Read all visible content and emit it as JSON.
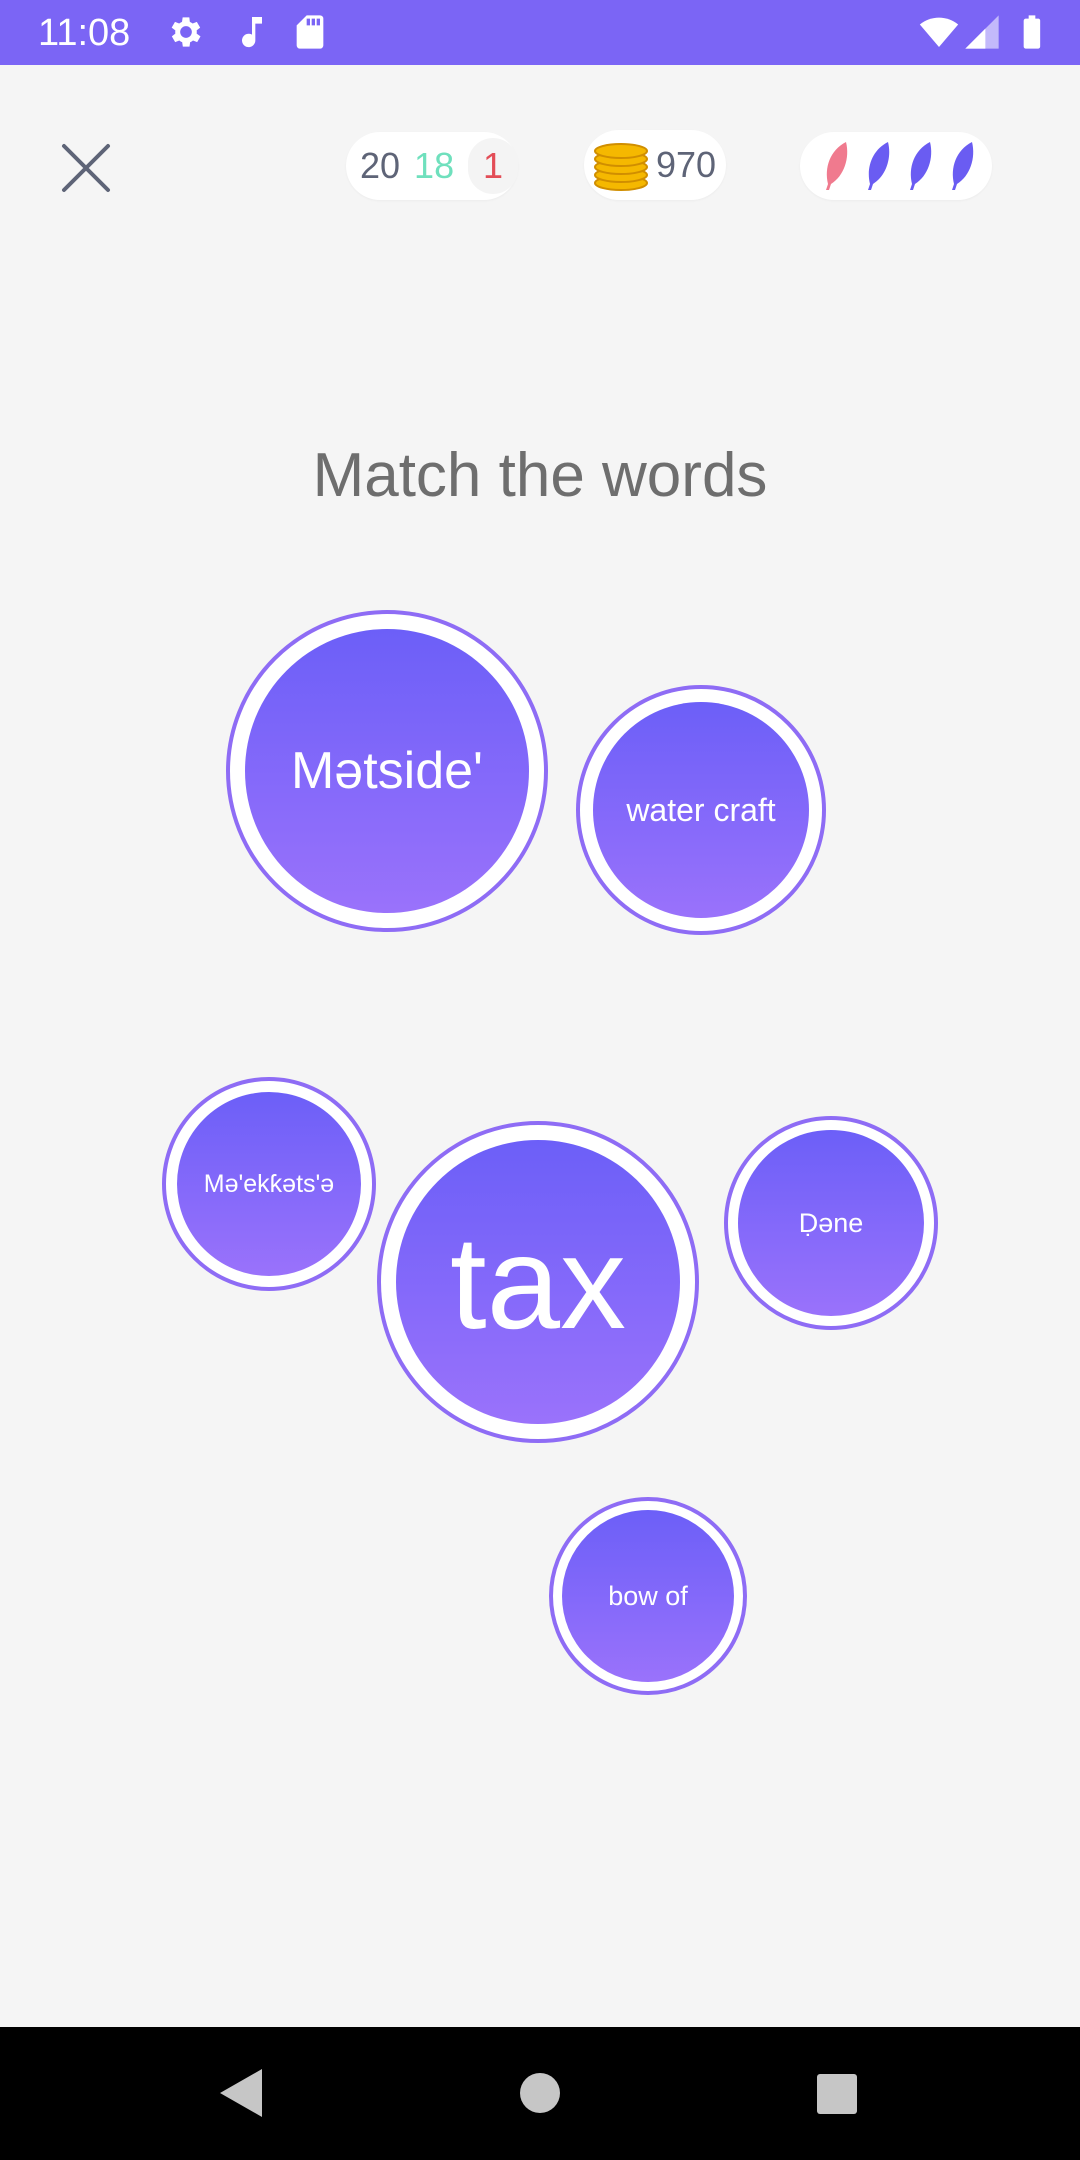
{
  "status_bar": {
    "time": "11:08",
    "left_icons": [
      "gear-icon",
      "music-note-icon",
      "sd-card-icon"
    ],
    "right_icons": [
      "wifi-icon",
      "signal-icon",
      "battery-icon"
    ]
  },
  "header": {
    "close_icon": "close-icon",
    "score": {
      "total": "20",
      "correct": "18",
      "wrong": "1"
    },
    "coins": "970",
    "feathers": [
      {
        "icon": "feather-icon",
        "color": "#f07a8e"
      },
      {
        "icon": "feather-icon",
        "color": "#6a5cf2"
      },
      {
        "icon": "feather-icon",
        "color": "#6a5cf2"
      },
      {
        "icon": "feather-icon",
        "color": "#6a5cf2"
      }
    ]
  },
  "prompt": "Match the words",
  "bubbles": [
    {
      "label": "Mətside'"
    },
    {
      "label": "water craft"
    },
    {
      "label": "Mə'ekƙəts'ə"
    },
    {
      "label": "tax"
    },
    {
      "label": "Ḍəne"
    },
    {
      "label": "bow of"
    }
  ],
  "colors": {
    "accent": "#7b65f5",
    "bubble_top": "#6c5ff8",
    "bubble_bottom": "#9a72fb",
    "correct": "#6fe0bd",
    "wrong": "#e34d57"
  },
  "nav_bar": {
    "buttons": [
      "back-icon",
      "home-icon",
      "recents-icon"
    ]
  }
}
